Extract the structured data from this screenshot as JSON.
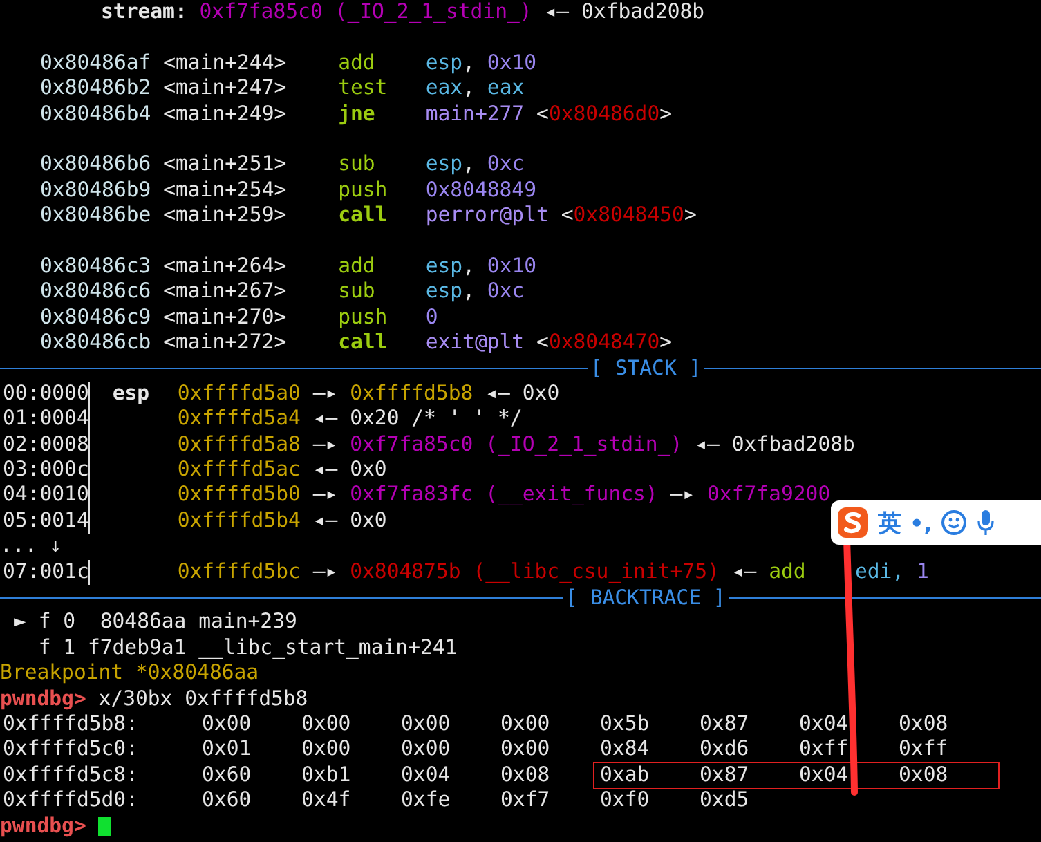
{
  "stream_line": {
    "label": "stream:",
    "tokens": [
      {
        "text": "0xf7fa85c0",
        "kind": "data"
      },
      {
        "text": "(_IO_2_1_stdin_)",
        "kind": "data"
      },
      {
        "text": "◂—",
        "kind": "plain"
      },
      {
        "text": "0xfbad208b",
        "kind": "plain"
      }
    ]
  },
  "disassembly": [
    [
      {
        "address": "0x80486af",
        "offset": "<main+244>",
        "mnemonic": "add",
        "branch": false,
        "operands": [
          {
            "text": "esp",
            "kind": "reg"
          },
          {
            "text": ",",
            "kind": "plain",
            "tight": true
          },
          {
            "text": "0x10",
            "kind": "num"
          }
        ]
      },
      {
        "address": "0x80486b2",
        "offset": "<main+247>",
        "mnemonic": "test",
        "branch": false,
        "operands": [
          {
            "text": "eax",
            "kind": "reg"
          },
          {
            "text": ",",
            "kind": "plain",
            "tight": true
          },
          {
            "text": "eax",
            "kind": "reg"
          }
        ]
      },
      {
        "address": "0x80486b4",
        "offset": "<main+249>",
        "mnemonic": "jne",
        "branch": true,
        "operands": [
          {
            "text": "main+277",
            "kind": "sym"
          },
          {
            "text": "<",
            "kind": "plain"
          },
          {
            "text": "0x80486d0",
            "kind": "code",
            "tight": true
          },
          {
            "text": ">",
            "kind": "plain",
            "tight": true
          }
        ]
      }
    ],
    [
      {
        "address": "0x80486b6",
        "offset": "<main+251>",
        "mnemonic": "sub",
        "branch": false,
        "operands": [
          {
            "text": "esp",
            "kind": "reg"
          },
          {
            "text": ",",
            "kind": "plain",
            "tight": true
          },
          {
            "text": "0xc",
            "kind": "num"
          }
        ]
      },
      {
        "address": "0x80486b9",
        "offset": "<main+254>",
        "mnemonic": "push",
        "branch": false,
        "operands": [
          {
            "text": "0x8048849",
            "kind": "num"
          }
        ]
      },
      {
        "address": "0x80486be",
        "offset": "<main+259>",
        "mnemonic": "call",
        "branch": true,
        "operands": [
          {
            "text": "perror@plt",
            "kind": "sym"
          },
          {
            "text": "<",
            "kind": "plain"
          },
          {
            "text": "0x8048450",
            "kind": "code",
            "tight": true
          },
          {
            "text": ">",
            "kind": "plain",
            "tight": true
          }
        ]
      }
    ],
    [
      {
        "address": "0x80486c3",
        "offset": "<main+264>",
        "mnemonic": "add",
        "branch": false,
        "operands": [
          {
            "text": "esp",
            "kind": "reg"
          },
          {
            "text": ",",
            "kind": "plain",
            "tight": true
          },
          {
            "text": "0x10",
            "kind": "num"
          }
        ]
      },
      {
        "address": "0x80486c6",
        "offset": "<main+267>",
        "mnemonic": "sub",
        "branch": false,
        "operands": [
          {
            "text": "esp",
            "kind": "reg"
          },
          {
            "text": ",",
            "kind": "plain",
            "tight": true
          },
          {
            "text": "0xc",
            "kind": "num"
          }
        ]
      },
      {
        "address": "0x80486c9",
        "offset": "<main+270>",
        "mnemonic": "push",
        "branch": false,
        "operands": [
          {
            "text": "0",
            "kind": "num"
          }
        ]
      },
      {
        "address": "0x80486cb",
        "offset": "<main+272>",
        "mnemonic": "call",
        "branch": true,
        "operands": [
          {
            "text": "exit@plt",
            "kind": "sym"
          },
          {
            "text": "<",
            "kind": "plain"
          },
          {
            "text": "0x8048470",
            "kind": "code",
            "tight": true
          },
          {
            "text": ">",
            "kind": "plain",
            "tight": true
          }
        ]
      }
    ]
  ],
  "stack": {
    "title": "[ STACK ]",
    "rows": [
      {
        "kind": "entry",
        "offset": "00:0000",
        "register": "esp",
        "tokens": [
          {
            "text": "0xffffd5a0",
            "kind": "stack"
          },
          {
            "text": "—▸",
            "kind": "plain"
          },
          {
            "text": "0xffffd5b8",
            "kind": "stack"
          },
          {
            "text": "◂—",
            "kind": "plain"
          },
          {
            "text": "0x0",
            "kind": "plain"
          }
        ]
      },
      {
        "kind": "entry",
        "offset": "01:0004",
        "tokens": [
          {
            "text": "0xffffd5a4",
            "kind": "stack"
          },
          {
            "text": "◂—",
            "kind": "plain"
          },
          {
            "text": "0x20 /* ' ' */",
            "kind": "plain"
          }
        ]
      },
      {
        "kind": "entry",
        "offset": "02:0008",
        "tokens": [
          {
            "text": "0xffffd5a8",
            "kind": "stack"
          },
          {
            "text": "—▸",
            "kind": "plain"
          },
          {
            "text": "0xf7fa85c0",
            "kind": "data"
          },
          {
            "text": "(_IO_2_1_stdin_)",
            "kind": "data"
          },
          {
            "text": "◂—",
            "kind": "plain"
          },
          {
            "text": "0xfbad208b",
            "kind": "plain"
          }
        ]
      },
      {
        "kind": "entry",
        "offset": "03:000c",
        "tokens": [
          {
            "text": "0xffffd5ac",
            "kind": "stack"
          },
          {
            "text": "◂—",
            "kind": "plain"
          },
          {
            "text": "0x0",
            "kind": "plain"
          }
        ]
      },
      {
        "kind": "entry",
        "offset": "04:0010",
        "tokens": [
          {
            "text": "0xffffd5b0",
            "kind": "stack"
          },
          {
            "text": "—▸",
            "kind": "plain"
          },
          {
            "text": "0xf7fa83fc",
            "kind": "data"
          },
          {
            "text": "(__exit_funcs)",
            "kind": "data"
          },
          {
            "text": "—▸",
            "kind": "plain"
          },
          {
            "text": "0xf7fa9200",
            "kind": "data"
          }
        ]
      },
      {
        "kind": "entry",
        "offset": "05:0014",
        "tokens": [
          {
            "text": "0xffffd5b4",
            "kind": "stack"
          },
          {
            "text": "◂—",
            "kind": "plain"
          },
          {
            "text": "0x0",
            "kind": "plain"
          }
        ]
      },
      {
        "kind": "ellipsis",
        "text": "... ↓"
      },
      {
        "kind": "entry",
        "offset": "07:001c",
        "tokens": [
          {
            "text": "0xffffd5bc",
            "kind": "stack"
          },
          {
            "text": "—▸",
            "kind": "plain"
          },
          {
            "text": "0x804875b",
            "kind": "code"
          },
          {
            "text": "(__libc_csu_init+75)",
            "kind": "code"
          },
          {
            "text": "◂—",
            "kind": "plain"
          },
          {
            "text": "add",
            "kind": "instr"
          },
          {
            "text": "   edi,",
            "kind": "reg"
          },
          {
            "text": "1",
            "kind": "num"
          }
        ]
      }
    ]
  },
  "backtrace": {
    "title": "[ BACKTRACE ]",
    "frames": [
      {
        "marker": "►",
        "text": "f 0  80486aa main+239"
      },
      {
        "text": "f 1 f7deb9a1 __libc_start_main+241"
      }
    ]
  },
  "console": {
    "breakpoint": "Breakpoint *0x80486aa",
    "prompt": "pwndbg>",
    "command": "x/30bx 0xffffd5b8",
    "memory": [
      {
        "address": "0xffffd5b8:",
        "low": [
          "0x00",
          "0x00",
          "0x00",
          "0x00"
        ],
        "high": [
          "0x5b",
          "0x87",
          "0x04",
          "0x08"
        ],
        "high_boxed": false
      },
      {
        "address": "0xffffd5c0:",
        "low": [
          "0x01",
          "0x00",
          "0x00",
          "0x00"
        ],
        "high": [
          "0x84",
          "0xd6",
          "0xff",
          "0xff"
        ],
        "high_boxed": false
      },
      {
        "address": "0xffffd5c8:",
        "low": [
          "0x60",
          "0xb1",
          "0x04",
          "0x08"
        ],
        "high": [
          "0xab",
          "0x87",
          "0x04",
          "0x08"
        ],
        "high_boxed": true
      },
      {
        "address": "0xffffd5d0:",
        "low": [
          "0x60",
          "0x4f",
          "0xfe",
          "0xf7"
        ],
        "high": [
          "0xf0",
          "0xd5"
        ],
        "high_boxed": false
      }
    ],
    "last_prompt": "pwndbg>",
    "cursor": true
  },
  "ime_toolbar": {
    "mode": "英",
    "punctuation": "•,"
  }
}
